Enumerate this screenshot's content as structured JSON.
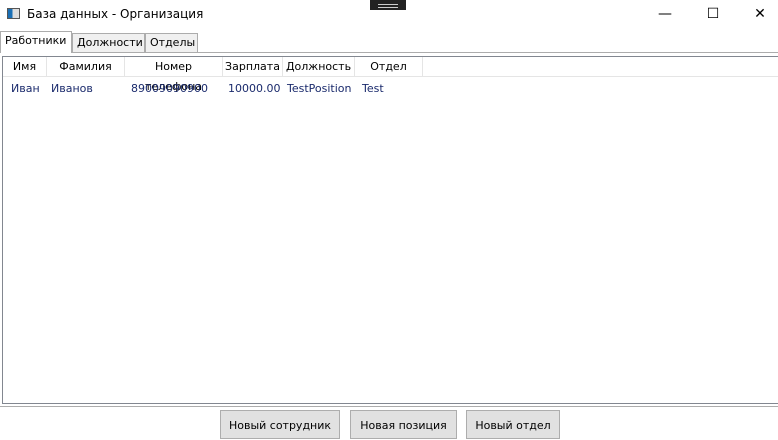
{
  "window": {
    "title": "База данных - Организация",
    "minimize": "—",
    "maximize": "☐",
    "close": "✕"
  },
  "tabs": [
    {
      "label": "Работники"
    },
    {
      "label": "Должности"
    },
    {
      "label": "Отделы"
    }
  ],
  "table": {
    "columns": [
      "Имя",
      "Фамилия",
      "Номер телефона",
      "Зарплата",
      "Должность",
      "Отдел"
    ],
    "rows": [
      [
        "Иван",
        "Иванов",
        "89009090900",
        "10000.00",
        "TestPosition",
        "Test"
      ]
    ]
  },
  "buttons": {
    "new_employee": "Новый сотрудник",
    "new_position": "Новая позиция",
    "new_department": "Новый отдел"
  }
}
